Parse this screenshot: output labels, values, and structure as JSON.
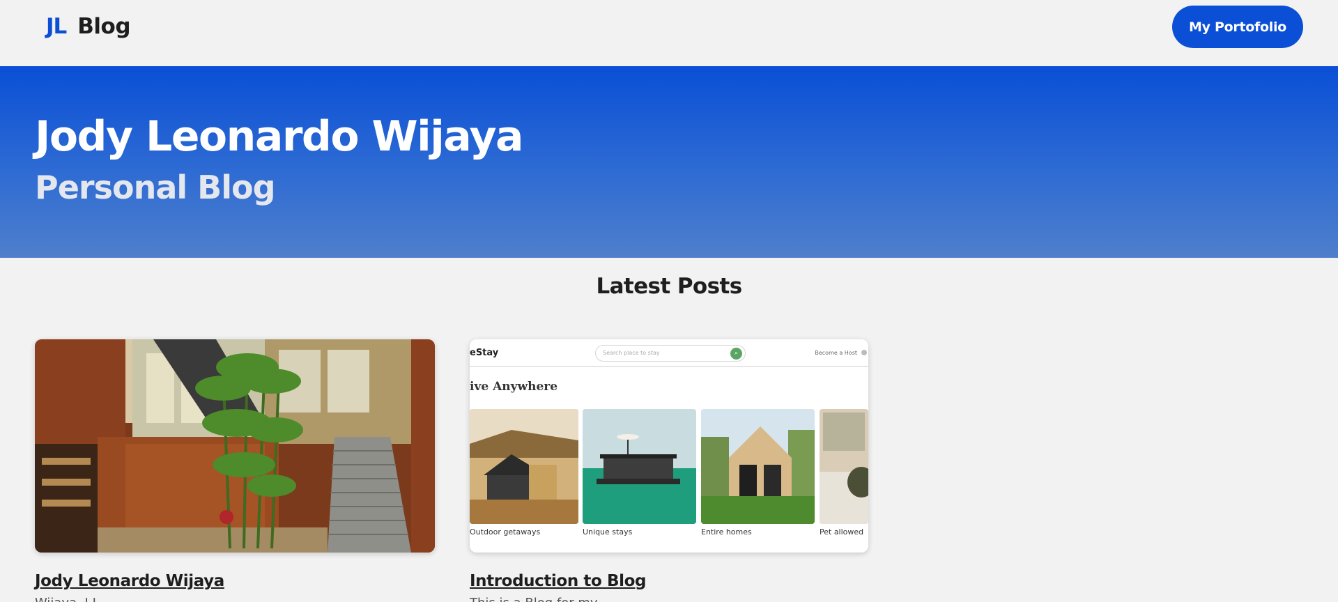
{
  "nav": {
    "logo_mark": "JL",
    "logo_text": "Blog",
    "portfolio_button": "My Portofolio"
  },
  "hero": {
    "title": "Jody Leonardo Wijaya",
    "subtitle": "Personal Blog"
  },
  "section": {
    "title": "Latest Posts"
  },
  "posts": [
    {
      "title": "Jody Leonardo Wijaya",
      "excerpt": "Wijaya, J.L."
    },
    {
      "title": "Introduction to Blog",
      "excerpt": "This is a Blog for my...",
      "preview": {
        "brand": "eStay",
        "search_placeholder": "Search place to stay",
        "host_link": "Become a Host",
        "heading": "ive Anywhere",
        "categories": [
          "Outdoor getaways",
          "Unique stays",
          "Entire homes",
          "Pet allowed"
        ]
      }
    }
  ],
  "colors": {
    "accent": "#0a4fd6",
    "hero_top": "#0a4fd6",
    "hero_bottom": "#4f7fcc",
    "background": "#f2f2f2"
  }
}
